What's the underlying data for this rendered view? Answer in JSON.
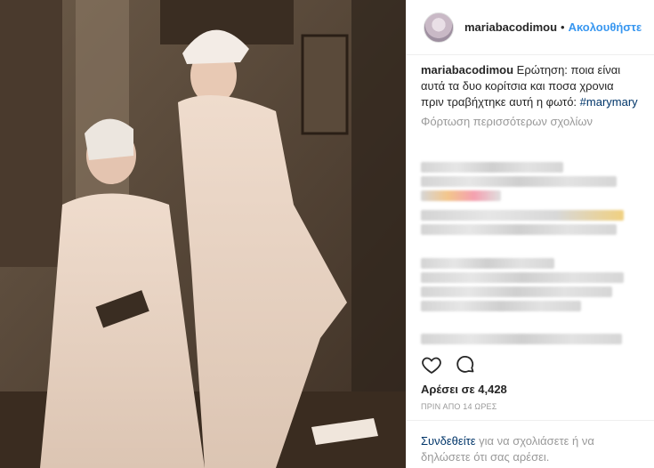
{
  "photo": {
    "alt_icon": "photo-image",
    "bg": "#5a4a3a"
  },
  "header": {
    "username": "mariabacodimou",
    "separator": "•",
    "follow_label": "Ακολουθήστε",
    "accent": "#3897f0"
  },
  "caption": {
    "username": "mariabacodimou",
    "text": "Ερώτηση: ποια είναι αυτά τα δυο κορίτσια και ποσα χρονια πριν τραβήχτηκε αυτή η φωτό:",
    "hashtag": "#marymary"
  },
  "comments": {
    "load_more": "Φόρτωση περισσότερων σχολίων"
  },
  "actions": {
    "like_icon": "heart-icon",
    "comment_icon": "comment-icon"
  },
  "likes": {
    "text": "Αρέσει σε 4,428"
  },
  "timestamp": "ΠΡΙΝ ΑΠΟ 14 ΩΡΕΣ",
  "login": {
    "link": "Συνδεθείτε",
    "rest": " για να σχολιάσετε ή να δηλώσετε ότι σας αρέσει."
  }
}
